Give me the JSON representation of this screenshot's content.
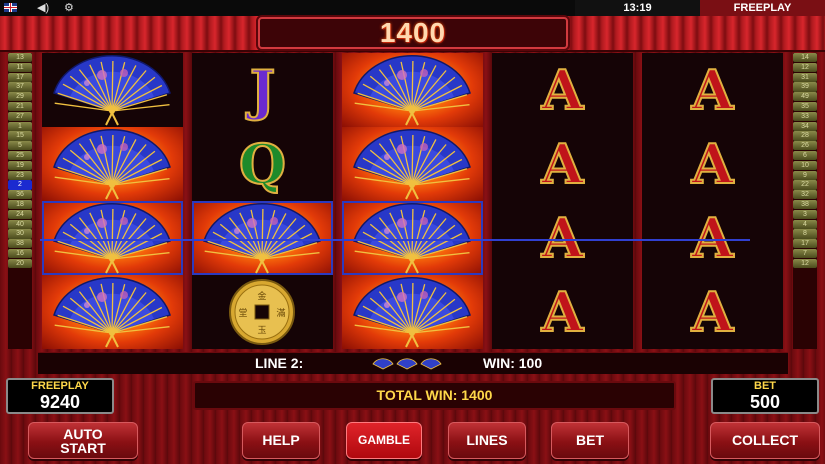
{
  "topbar": {
    "clock": "13:19",
    "mode": "FREEPLAY",
    "icons": [
      "uk-flag-icon",
      "volume-icon",
      "settings-icon"
    ]
  },
  "total_win_display": "1400",
  "lines_left": [
    "13",
    "11",
    "17",
    "37",
    "29",
    "21",
    "27",
    "1",
    "15",
    "5",
    "25",
    "19",
    "23",
    "2",
    "36",
    "18",
    "24",
    "40",
    "30",
    "38",
    "16",
    "20"
  ],
  "lines_right": [
    "14",
    "12",
    "31",
    "39",
    "49",
    "35",
    "33",
    "34",
    "28",
    "26",
    "6",
    "10",
    "9",
    "22",
    "32",
    "38",
    "3",
    "4",
    "8",
    "17",
    "7",
    "12"
  ],
  "active_line": "2",
  "reels": [
    {
      "symbols": [
        "fan",
        "fan",
        "fan",
        "fan"
      ],
      "backgrounds": [
        "dark",
        "fire",
        "fire",
        "fire"
      ],
      "selected": [
        false,
        false,
        true,
        false
      ]
    },
    {
      "symbols": [
        "J",
        "Q",
        "fan",
        "coin"
      ],
      "backgrounds": [
        "dark",
        "dark",
        "fire",
        "dark"
      ],
      "selected": [
        false,
        false,
        true,
        false
      ]
    },
    {
      "symbols": [
        "fan",
        "fan",
        "fan",
        "fan"
      ],
      "backgrounds": [
        "fire",
        "fire",
        "fire",
        "fire"
      ],
      "selected": [
        false,
        false,
        true,
        false
      ]
    },
    {
      "symbols": [
        "A",
        "A",
        "A",
        "A"
      ],
      "backgrounds": [
        "dark",
        "dark",
        "dark",
        "dark"
      ],
      "selected": [
        false,
        false,
        false,
        false
      ]
    },
    {
      "symbols": [
        "A",
        "A",
        "A",
        "A"
      ],
      "backgrounds": [
        "dark",
        "dark",
        "dark",
        "dark"
      ],
      "selected": [
        false,
        false,
        false,
        false
      ]
    }
  ],
  "info": {
    "line_text": "LINE 2:",
    "win_text": "WIN: 100",
    "fan_count": 3
  },
  "balance": {
    "label": "FREEPLAY",
    "value": "9240"
  },
  "bet": {
    "label": "BET",
    "value": "500"
  },
  "total_win_text": "TOTAL WIN: 1400",
  "buttons": {
    "auto_start_line1": "AUTO",
    "auto_start_line2": "START",
    "help": "HELP",
    "gamble": "GAMBLE",
    "lines": "LINES",
    "bet": "BET",
    "collect": "COLLECT"
  },
  "colors": {
    "payline": "#3040d0",
    "gold": "#ffd84a",
    "frame_red": "#8a1015"
  }
}
